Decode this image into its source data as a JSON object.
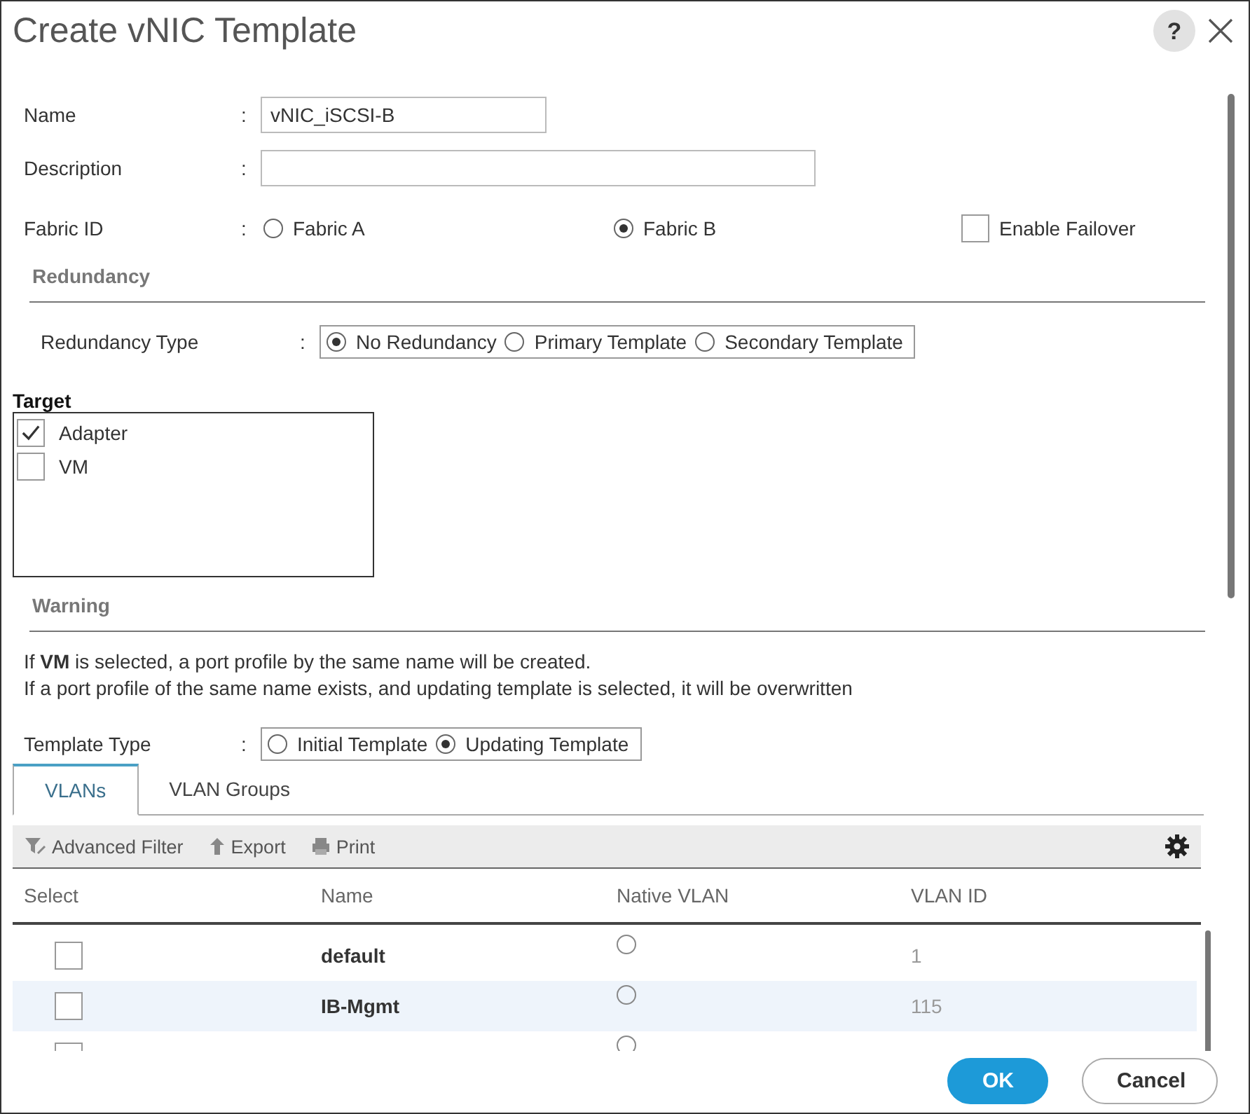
{
  "window": {
    "title": "Create vNIC Template",
    "help": "?"
  },
  "fields": [
    {
      "label": "Name",
      "separator": ":",
      "value": "vNIC_iSCSI-B"
    },
    {
      "label": "Description",
      "separator": ":"
    }
  ],
  "fabric": {
    "label": "Fabric ID",
    "separator": ":",
    "options": [
      {
        "label": "Fabric A",
        "selected": false
      },
      {
        "label": "Fabric B",
        "selected": true
      }
    ],
    "failover": {
      "label": "Enable Failover",
      "checked": false
    }
  },
  "redundancy": {
    "heading": "Redundancy",
    "label": "Redundancy Type",
    "separator": ":",
    "options": [
      {
        "label": "No Redundancy",
        "selected": true
      },
      {
        "label": "Primary Template",
        "selected": false
      },
      {
        "label": "Secondary Template",
        "selected": false
      }
    ]
  },
  "target": {
    "heading": "Target",
    "items": [
      {
        "label": "Adapter",
        "checked": true
      },
      {
        "label": "VM",
        "checked": false
      }
    ]
  },
  "warning": {
    "heading": "Warning",
    "lines": [
      "If **VM** is selected, a port profile by the same name will be created.",
      "If a port profile of the same name exists, and updating template is selected, it will be overwritten"
    ]
  },
  "template_type": {
    "label": "Template Type",
    "separator": ":",
    "options": [
      {
        "label": "Initial Template",
        "selected": false
      },
      {
        "label": "Updating Template",
        "selected": true
      }
    ]
  },
  "tabs": [
    {
      "label": "VLANs",
      "selected": true
    },
    {
      "label": "VLAN Groups",
      "selected": false
    }
  ],
  "toolbar": [
    {
      "kind": "filter",
      "label": "Advanced Filter"
    },
    {
      "kind": "export",
      "label": "Export"
    },
    {
      "kind": "print",
      "label": "Print"
    }
  ],
  "table": {
    "columns": [
      "Select",
      "Name",
      "Native VLAN",
      "VLAN ID"
    ],
    "rows": [
      {
        "checked": false,
        "name": "default",
        "native": false,
        "vlan_id": "1",
        "selected": false
      },
      {
        "checked": false,
        "name": "IB-Mgmt",
        "native": false,
        "vlan_id": "115",
        "selected": true
      },
      {
        "checked": false,
        "native": false,
        "selected": false
      }
    ]
  },
  "buttons": [
    {
      "kind": "primary",
      "label": "OK"
    },
    {
      "kind": "secondary",
      "label": "Cancel"
    }
  ]
}
